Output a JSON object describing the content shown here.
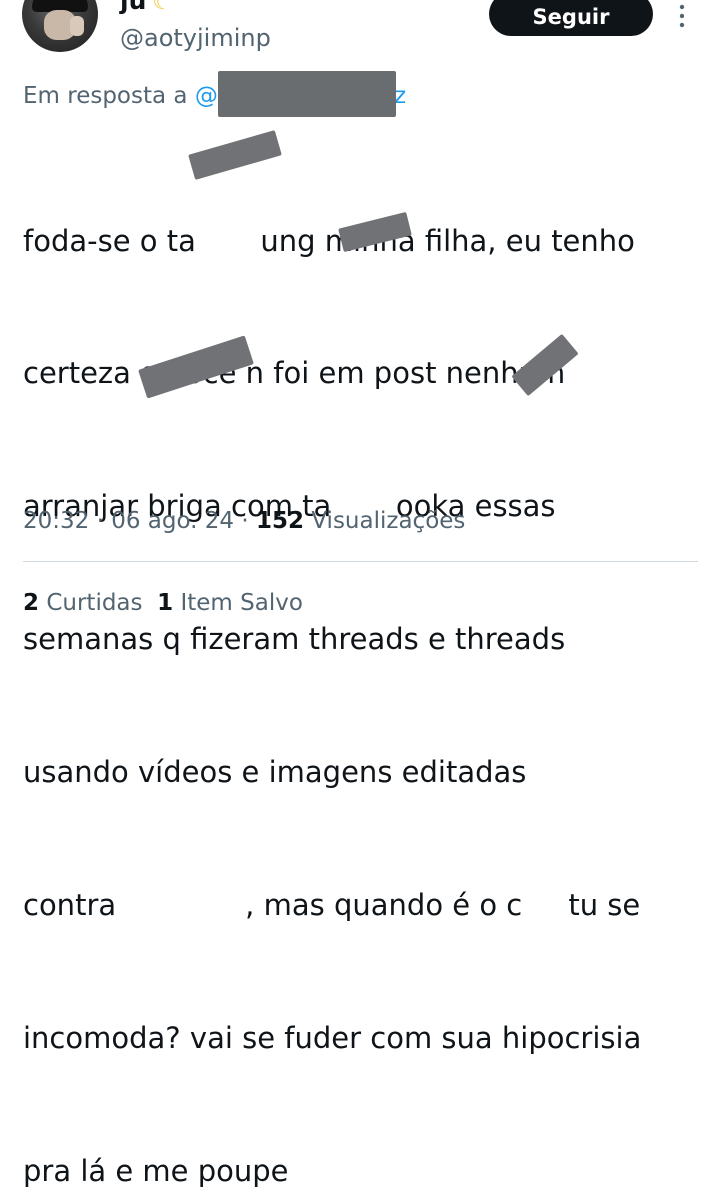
{
  "user": {
    "display_name": "ju",
    "handle": "@aotyjiminp"
  },
  "follow_label": "Seguir",
  "reply": {
    "prefix": "Em resposta a",
    "mention_start": "@",
    "mention_end": "z"
  },
  "tweet_lines": [
    "foda-se o ta       ung minha filha, eu tenho",
    "certeza q você n foi em post nenhum",
    "arranjar briga com ta       ooka essas",
    "semanas q fizeram threads e threads",
    "usando vídeos e imagens editadas",
    "contra              , mas quando é o c     tu se",
    "incomoda? vai se fuder com sua hipocrisia",
    "pra lá e me poupe"
  ],
  "meta": {
    "time": "20:32",
    "sep1": " · ",
    "date": "06 ago. 24",
    "sep2": " · ",
    "views_count": "152",
    "views_label": " Visualizações"
  },
  "stats": {
    "reposts_count": "2",
    "reposts_label": "Curtidas",
    "saves_count": "1",
    "saves_label": "Item Salvo"
  },
  "icons": {
    "avatar": "avatar",
    "moon": "crescent-moon-icon",
    "more": "more-options-icon"
  }
}
